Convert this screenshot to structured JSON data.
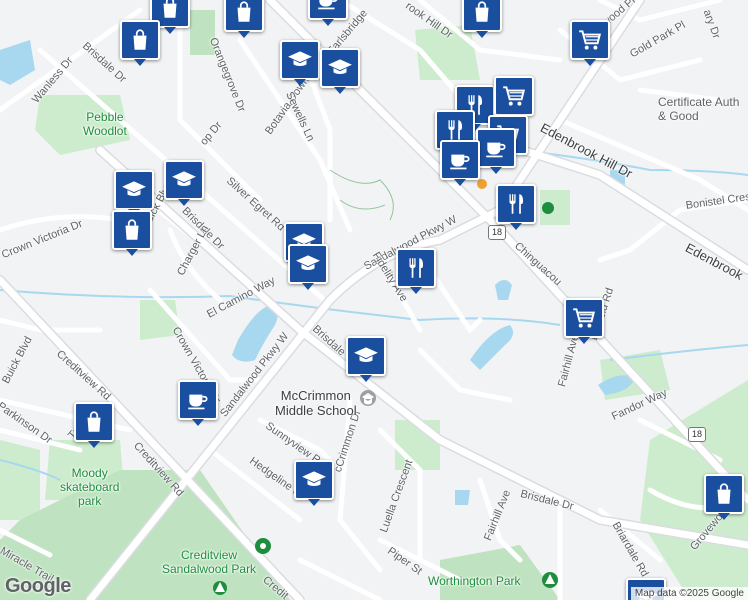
{
  "map": {
    "logo": "Google",
    "attribution": "Map data ©2025 Google",
    "highway_number": "18",
    "pin_color": "#1a4fa0"
  },
  "streets": {
    "wanless": "Wanless Dr",
    "brisdale": "Brisdale Dr",
    "brisdale_trunc": "Brisdale",
    "orangegrove": "Orangegrove Dr",
    "botavia": "Botavia Downs Dr",
    "earlsbridge": "Earlsbridge",
    "sewells": "Sewells Ln",
    "op_dr": "op Dr",
    "silver_egret": "Silver Egret Rd",
    "buick": "Buick Blvd",
    "crown_victoria": "Crown Victoria Dr",
    "charger": "Charger Ln",
    "el_camino": "El Camino Way",
    "sandalwood": "Sandalwood Pkwy W",
    "fidelity": "Fidelity Ave",
    "creditview": "Creditview Rd",
    "parkinson": "Parkinson Dr",
    "tr": "Tr",
    "miracle": "Miracle Trail",
    "sunnyview": "Sunnyview Rd",
    "mccrimmon_dr": "cCrimmon Dr",
    "hedgeline": "Hedgeline St",
    "luella": "Luella Crescent",
    "piper": "Piper St",
    "fairhill": "Fairhill Ave",
    "fandor": "Fandor Way",
    "briardale": "Briardale Rd",
    "grovewood": "Grovewo",
    "duffield": "Duffield Rd",
    "chinguacousy": "Chinguacou",
    "edenbrook_hill": "Edenbrook Hill Dr",
    "edenbrook": "Edenbrook",
    "bonistel": "Bonistel Cres",
    "brook_hill": "rook Hill Dr",
    "wood_pl": "wood Pl",
    "gold_park": "Gold Park Pl",
    "ary_dr": "ary Dr",
    "credit_trunc": "Credit"
  },
  "places": {
    "pebble_1": "Pebble",
    "pebble_2": "Woodlot",
    "moody_1": "Moody",
    "moody_2": "skateboard",
    "moody_3": "park",
    "mccrimmon_1": "McCrimmon",
    "mccrimmon_2": "Middle School",
    "cvsw_1": "Creditview",
    "cvsw_2": "Sandalwood Park",
    "worthington": "Worthington Park",
    "cert_1": "Certificate Auth",
    "cert_2": "& Good"
  },
  "pins": [
    {
      "type": "shopping",
      "icon": "shopping-bag-icon"
    },
    {
      "type": "shopping",
      "icon": "shopping-bag-icon"
    },
    {
      "type": "shopping",
      "icon": "shopping-bag-icon"
    },
    {
      "type": "cafe",
      "icon": "coffee-cup-icon"
    },
    {
      "type": "school",
      "icon": "graduation-cap-icon"
    },
    {
      "type": "school",
      "icon": "graduation-cap-icon"
    },
    {
      "type": "shopping",
      "icon": "shopping-bag-icon"
    },
    {
      "type": "grocery",
      "icon": "shopping-cart-icon"
    },
    {
      "type": "restaurant",
      "icon": "fork-knife-icon"
    },
    {
      "type": "grocery",
      "icon": "shopping-cart-icon"
    },
    {
      "type": "grocery",
      "icon": "shopping-cart-icon"
    },
    {
      "type": "restaurant",
      "icon": "fork-knife-icon"
    },
    {
      "type": "cafe",
      "icon": "coffee-cup-icon"
    },
    {
      "type": "cafe",
      "icon": "coffee-cup-icon"
    },
    {
      "type": "school",
      "icon": "graduation-cap-icon"
    },
    {
      "type": "school",
      "icon": "graduation-cap-icon"
    },
    {
      "type": "shopping",
      "icon": "shopping-bag-icon"
    },
    {
      "type": "school",
      "icon": "graduation-cap-icon"
    },
    {
      "type": "school",
      "icon": "graduation-cap-icon"
    },
    {
      "type": "restaurant",
      "icon": "fork-knife-icon"
    },
    {
      "type": "restaurant",
      "icon": "fork-knife-icon"
    },
    {
      "type": "grocery",
      "icon": "shopping-cart-icon"
    },
    {
      "type": "school",
      "icon": "graduation-cap-icon"
    },
    {
      "type": "cafe",
      "icon": "coffee-cup-icon"
    },
    {
      "type": "shopping",
      "icon": "shopping-bag-icon"
    },
    {
      "type": "school",
      "icon": "graduation-cap-icon"
    },
    {
      "type": "shopping",
      "icon": "shopping-bag-icon"
    },
    {
      "type": "school",
      "icon": "graduation-cap-icon"
    }
  ]
}
